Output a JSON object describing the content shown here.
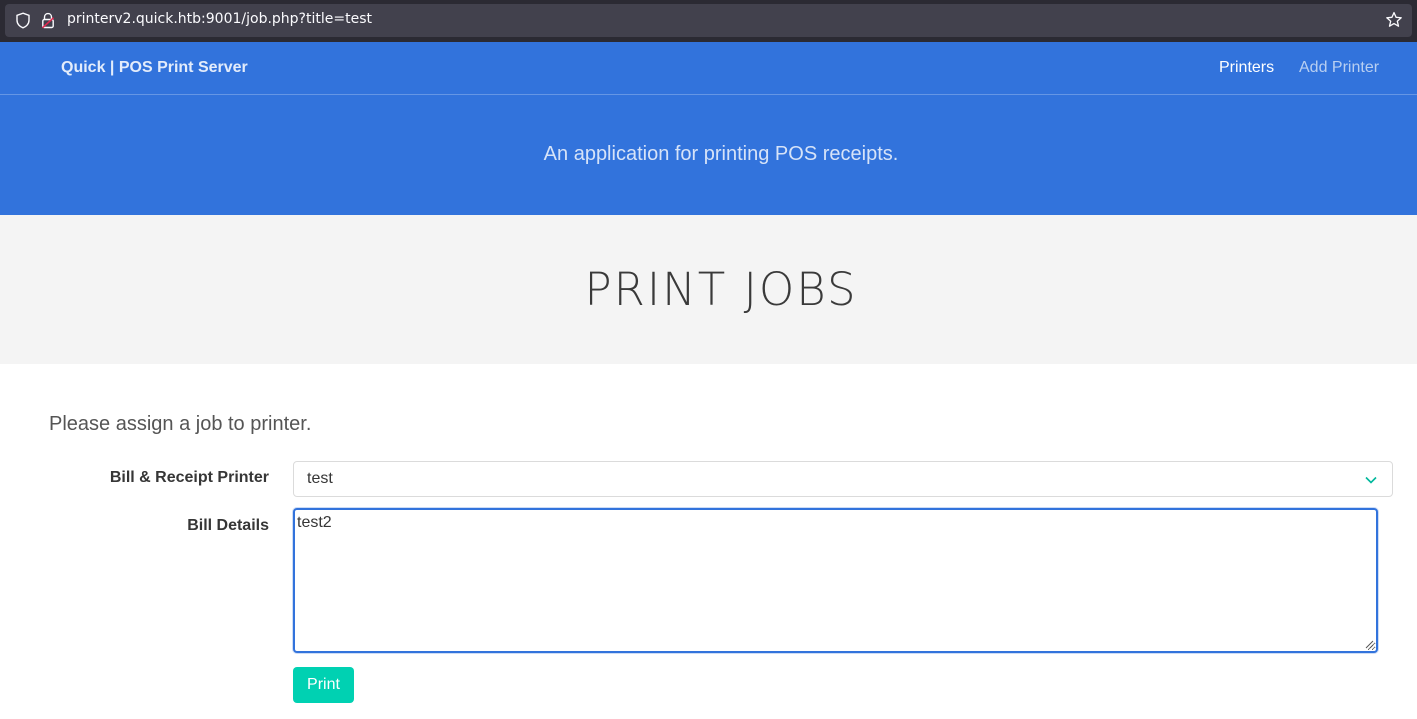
{
  "browser": {
    "url": "printerv2.quick.htb:9001/job.php?title=test",
    "icons": [
      "shield-icon",
      "lock-icon",
      "bookmark-star-icon"
    ]
  },
  "navbar": {
    "brand": "Quick | POS Print Server",
    "links": [
      {
        "label": "Printers"
      },
      {
        "label": "Add Printer"
      }
    ]
  },
  "hero": {
    "subtitle": "An application for printing POS receipts."
  },
  "page": {
    "title": "PRINT JOBS"
  },
  "form": {
    "intro": "Please assign a job to printer.",
    "printer_label": "Bill & Receipt Printer",
    "printer_value": "test",
    "details_label": "Bill Details",
    "details_value": "test2",
    "submit_label": "Print"
  },
  "colors": {
    "primary": "#3273dc",
    "accent": "#00d1b2",
    "title_band": "#f4f4f4"
  }
}
